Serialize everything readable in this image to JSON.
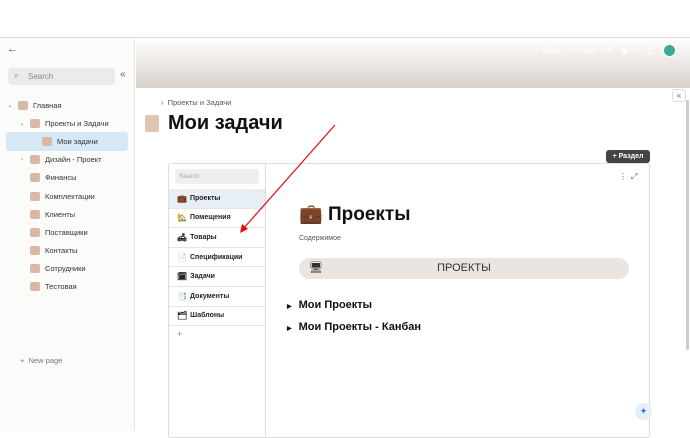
{
  "sidebar": {
    "search_placeholder": "Search",
    "items": [
      {
        "label": "Главная",
        "chevron": "⌄"
      },
      {
        "label": "Проекты и Задачи",
        "chevron": "⌄"
      },
      {
        "label": "Мои задачи",
        "chevron": ""
      },
      {
        "label": "Дизайн - Проект",
        "chevron": "›"
      },
      {
        "label": "Финансы",
        "chevron": ""
      },
      {
        "label": "Комплектации",
        "chevron": ""
      },
      {
        "label": "Клиенты",
        "chevron": ""
      },
      {
        "label": "Поставщики",
        "chevron": ""
      },
      {
        "label": "Контакты",
        "chevron": ""
      },
      {
        "label": "Сотрудники",
        "chevron": ""
      },
      {
        "label": "Тестовая",
        "chevron": ""
      }
    ],
    "new_page": "New page"
  },
  "toolbar": {
    "share": "Share",
    "insert": "Insert"
  },
  "page": {
    "breadcrumb": "Проекты и Задачи",
    "title": "Мои задачи",
    "add_section": "+ Раздел"
  },
  "panel": {
    "search_placeholder": "Search",
    "items": [
      {
        "emoji": "💼",
        "label": "Проекты"
      },
      {
        "emoji": "🏡",
        "label": "Помещения"
      },
      {
        "emoji": "🛋",
        "label": "Товары"
      },
      {
        "emoji": "📄",
        "label": "Спецификации"
      },
      {
        "emoji": "🗓",
        "label": "Задачи"
      },
      {
        "emoji": "📑",
        "label": "Документы"
      },
      {
        "emoji": "🗂",
        "label": "Шаблоны"
      }
    ],
    "add": "+",
    "heading": "Проекты",
    "heading_emoji": "💼",
    "subtitle": "Содержимое",
    "banner": "ПРОЕКТЫ",
    "toggles": [
      "Мои Проекты",
      "Мои Проекты - Канбан"
    ]
  },
  "colors": {
    "selected": "#d5e8f5",
    "arrow": "#e01010"
  }
}
